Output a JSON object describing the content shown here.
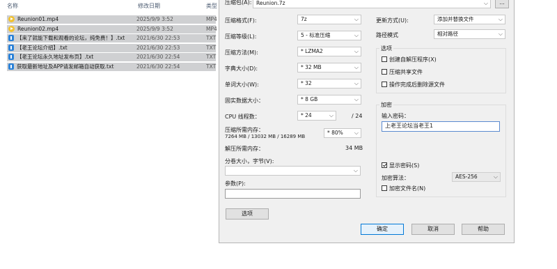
{
  "explorer": {
    "columns": {
      "name": "名称",
      "date": "修改日期",
      "type": "类型"
    },
    "files": [
      {
        "name": "Reunion01.mp4",
        "date": "2025/9/9 3:52",
        "type": "MP4",
        "icon": "video-file-icon"
      },
      {
        "name": "Reunion02.mp4",
        "date": "2025/9/9 3:52",
        "type": "MP4",
        "icon": "video-file-icon"
      },
      {
        "name": "【来了就能下载和观看的论坛，纯免费！】.txt",
        "date": "2021/6/30 22:53",
        "type": "TXT",
        "icon": "text-file-icon"
      },
      {
        "name": "【老王论坛介绍】.txt",
        "date": "2021/6/30 22:53",
        "type": "TXT",
        "icon": "text-file-icon"
      },
      {
        "name": "【老王论坛永久地址发布页】.txt",
        "date": "2021/6/30 22:54",
        "type": "TXT",
        "icon": "text-file-icon"
      },
      {
        "name": "获取最新地址及APP请发邮箱自动获取.txt",
        "date": "2021/6/30 22:54",
        "type": "TXT",
        "icon": "text-file-icon"
      }
    ]
  },
  "dialog": {
    "archive_label": "压缩包(A):",
    "archive_value": "Reunion.7z",
    "browse_label": "...",
    "format_label": "压缩格式(F):",
    "format_value": "7z",
    "level_label": "压缩等级(L):",
    "level_value": "5 - 标准压缩",
    "method_label": "压缩方法(M):",
    "method_value": "* LZMA2",
    "dict_label": "字典大小(D):",
    "dict_value": "* 32 MB",
    "word_label": "单词大小(W):",
    "word_value": "* 32",
    "solid_label": "固实数据大小：",
    "solid_value": "* 8 GB",
    "cpu_label": "CPU 线程数：",
    "cpu_value": "* 24",
    "cpu_total": "/ 24",
    "mem_comp_label": "压缩所需内存：",
    "mem_comp_detail": "7264 MB / 13032 MB / 16289 MB",
    "mem_percent": "* 80%",
    "mem_decomp_label": "解压所需内存：",
    "mem_decomp_value": "34 MB",
    "split_label": "分卷大小，字节(V):",
    "split_value": "",
    "params_label": "参数(P):",
    "params_value": "",
    "options_button": "选项",
    "update_label": "更新方式(U):",
    "update_value": "添加并替换文件",
    "path_label": "路径模式",
    "path_value": "相对路径",
    "opts_group": "选项",
    "opt_sfx": "创建自解压程序(X)",
    "opt_shared": "压缩共享文件",
    "opt_delete": "操作完成后删除源文件",
    "enc_group": "加密",
    "pwd_label": "输入密码：",
    "pwd_value": "上老王论坛当老王1",
    "show_pwd": "显示密码(S)",
    "enc_method_label": "加密算法：",
    "enc_method_value": "AES-256",
    "enc_names": "加密文件名(N)",
    "ok": "确定",
    "cancel": "取消",
    "help": "帮助"
  },
  "colors": {
    "selection": "#cfd0d2",
    "dialog_bg": "#f0f0f0",
    "accent": "#0078d7"
  }
}
